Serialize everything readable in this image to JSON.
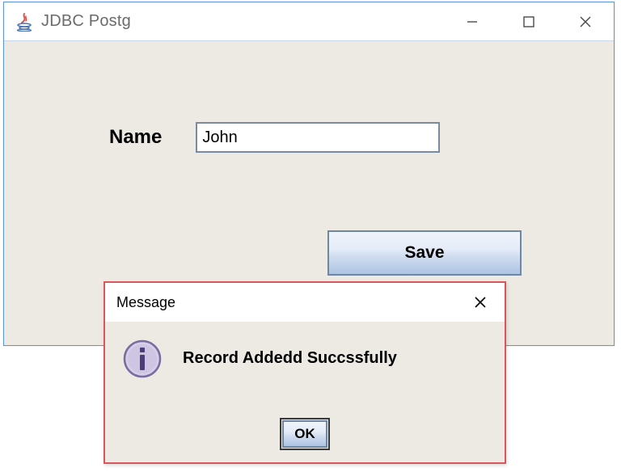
{
  "window": {
    "title": "JDBC Postg"
  },
  "form": {
    "name_label": "Name",
    "name_value": "John",
    "save_label": "Save"
  },
  "dialog": {
    "title": "Message",
    "message": "Record Addedd Succssfully",
    "ok_label": "OK"
  }
}
